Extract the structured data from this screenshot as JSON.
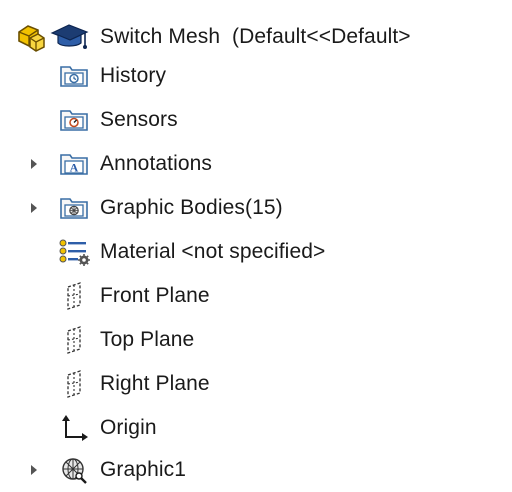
{
  "feature_tree": {
    "root": {
      "name": "Switch Mesh",
      "config": "(Default<<Default>",
      "icons": [
        "part-icon",
        "display-states-icon"
      ]
    },
    "items": [
      {
        "label": "History",
        "icon": "history-folder-icon",
        "expandable": false
      },
      {
        "label": "Sensors",
        "icon": "sensors-folder-icon",
        "expandable": false
      },
      {
        "label": "Annotations",
        "icon": "annotations-folder-icon",
        "expandable": true
      },
      {
        "label": "Graphic Bodies(15)",
        "icon": "graphic-bodies-folder-icon",
        "expandable": true
      },
      {
        "label": "Material <not specified>",
        "icon": "material-icon",
        "expandable": false
      },
      {
        "label": "Front Plane",
        "icon": "plane-icon",
        "expandable": false
      },
      {
        "label": "Top Plane",
        "icon": "plane-icon",
        "expandable": false
      },
      {
        "label": "Right Plane",
        "icon": "plane-icon",
        "expandable": false
      },
      {
        "label": "Origin",
        "icon": "origin-icon",
        "expandable": false
      },
      {
        "label": "Graphic1",
        "icon": "graphic-body-icon",
        "expandable": true
      }
    ]
  },
  "colors": {
    "folder_outline": "#3a6ea5",
    "folder_fill": "#f7f7f7",
    "part_yellow": "#f2c200",
    "arrow": "#555555"
  }
}
